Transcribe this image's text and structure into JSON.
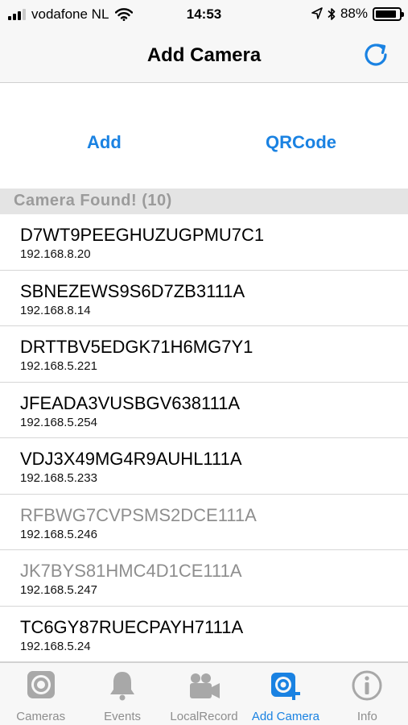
{
  "status_bar": {
    "carrier": "vodafone NL",
    "time": "14:53",
    "battery": "88%",
    "battery_level": 0.88
  },
  "nav": {
    "title": "Add Camera",
    "refresh_icon": "refresh-icon"
  },
  "actions": {
    "add_label": "Add",
    "qrcode_label": "QRCode"
  },
  "section": {
    "title": "Camera Found! (10)"
  },
  "devices": [
    {
      "name": "D7WT9PEEGHUZUGPMU7C1",
      "ip": "192.168.8.20",
      "dim": false
    },
    {
      "name": "SBNEZEWS9S6D7ZB3111A",
      "ip": "192.168.8.14",
      "dim": false
    },
    {
      "name": "DRTTBV5EDGK71H6MG7Y1",
      "ip": "192.168.5.221",
      "dim": false
    },
    {
      "name": "JFEADA3VUSBGV638111A",
      "ip": "192.168.5.254",
      "dim": false
    },
    {
      "name": "VDJ3X49MG4R9AUHL111A",
      "ip": "192.168.5.233",
      "dim": false
    },
    {
      "name": "RFBWG7CVPSMS2DCE111A",
      "ip": "192.168.5.246",
      "dim": true
    },
    {
      "name": "JK7BYS81HMC4D1CE111A",
      "ip": "192.168.5.247",
      "dim": true
    },
    {
      "name": "TC6GY87RUECPAYH7111A",
      "ip": "192.168.5.24",
      "dim": false
    }
  ],
  "tabs": [
    {
      "label": "Cameras",
      "icon": "camera-lens-icon",
      "active": false
    },
    {
      "label": "Events",
      "icon": "bell-icon",
      "active": false
    },
    {
      "label": "LocalRecord",
      "icon": "video-camera-icon",
      "active": false
    },
    {
      "label": "Add Camera",
      "icon": "add-camera-icon",
      "active": true
    },
    {
      "label": "Info",
      "icon": "info-icon",
      "active": false
    }
  ],
  "colors": {
    "accent": "#1a82e2",
    "inactive": "#8e8e8e"
  }
}
